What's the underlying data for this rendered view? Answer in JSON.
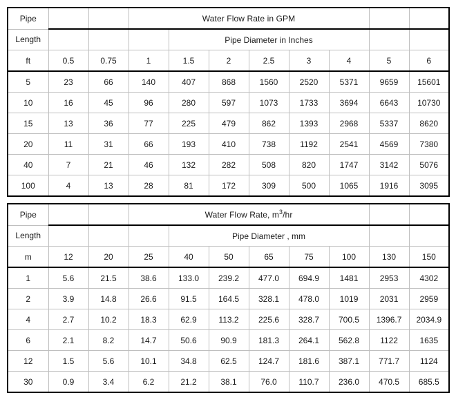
{
  "tables": [
    {
      "id": "gpm-table",
      "label_header_1": "Pipe",
      "label_header_2": "Length",
      "title": "Water Flow Rate in GPM",
      "subtitle": "Pipe Diameter in Inches",
      "unit_label": "ft",
      "columns": [
        "0.5",
        "0.75",
        "1",
        "1.5",
        "2",
        "2.5",
        "3",
        "4",
        "5",
        "6"
      ],
      "rows": [
        {
          "length": "5",
          "values": [
            "23",
            "66",
            "140",
            "407",
            "868",
            "1560",
            "2520",
            "5371",
            "9659",
            "15601"
          ]
        },
        {
          "length": "10",
          "values": [
            "16",
            "45",
            "96",
            "280",
            "597",
            "1073",
            "1733",
            "3694",
            "6643",
            "10730"
          ]
        },
        {
          "length": "15",
          "values": [
            "13",
            "36",
            "77",
            "225",
            "479",
            "862",
            "1393",
            "2968",
            "5337",
            "8620"
          ]
        },
        {
          "length": "20",
          "values": [
            "11",
            "31",
            "66",
            "193",
            "410",
            "738",
            "1192",
            "2541",
            "4569",
            "7380"
          ]
        },
        {
          "length": "40",
          "values": [
            "7",
            "21",
            "46",
            "132",
            "282",
            "508",
            "820",
            "1747",
            "3142",
            "5076"
          ]
        },
        {
          "length": "100",
          "values": [
            "4",
            "13",
            "28",
            "81",
            "172",
            "309",
            "500",
            "1065",
            "1916",
            "3095"
          ]
        }
      ]
    },
    {
      "id": "cubic-metre-table",
      "label_header_1": "Pipe",
      "label_header_2": "Length",
      "title_pre": "Water Flow Rate, m",
      "title_sup": "3",
      "title_post": "/hr",
      "title": "Water Flow Rate, m3/hr",
      "subtitle": "Pipe Diameter , mm",
      "unit_label": "m",
      "columns": [
        "12",
        "20",
        "25",
        "40",
        "50",
        "65",
        "75",
        "100",
        "130",
        "150"
      ],
      "rows": [
        {
          "length": "1",
          "values": [
            "5.6",
            "21.5",
            "38.6",
            "133.0",
            "239.2",
            "477.0",
            "694.9",
            "1481",
            "2953",
            "4302"
          ]
        },
        {
          "length": "2",
          "values": [
            "3.9",
            "14.8",
            "26.6",
            "91.5",
            "164.5",
            "328.1",
            "478.0",
            "1019",
            "2031",
            "2959"
          ]
        },
        {
          "length": "4",
          "values": [
            "2.7",
            "10.2",
            "18.3",
            "62.9",
            "113.2",
            "225.6",
            "328.7",
            "700.5",
            "1396.7",
            "2034.9"
          ]
        },
        {
          "length": "6",
          "values": [
            "2.1",
            "8.2",
            "14.7",
            "50.6",
            "90.9",
            "181.3",
            "264.1",
            "562.8",
            "1122",
            "1635"
          ]
        },
        {
          "length": "12",
          "values": [
            "1.5",
            "5.6",
            "10.1",
            "34.8",
            "62.5",
            "124.7",
            "181.6",
            "387.1",
            "771.7",
            "1124"
          ]
        },
        {
          "length": "30",
          "values": [
            "0.9",
            "3.4",
            "6.2",
            "21.2",
            "38.1",
            "76.0",
            "110.7",
            "236.0",
            "470.5",
            "685.5"
          ]
        }
      ]
    }
  ],
  "colors": {
    "border_strong": "#000000",
    "gridline": "#bfbfbf",
    "background": "#ffffff",
    "text": "#1a1a1a"
  }
}
